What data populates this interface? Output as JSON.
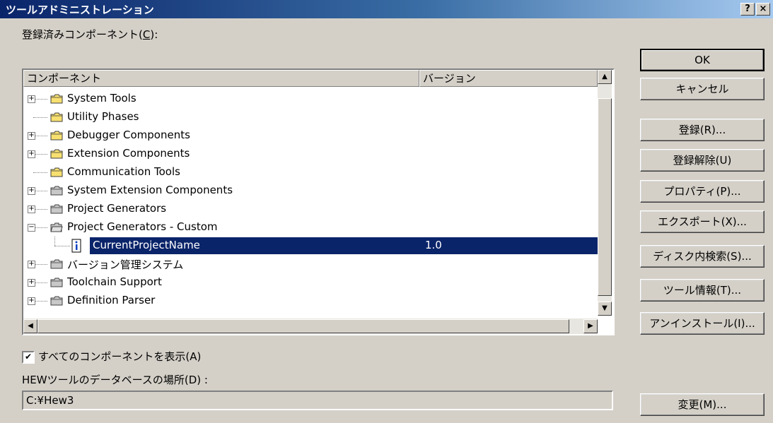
{
  "window": {
    "title": "ツールアドミニストレーション",
    "help_button": "?",
    "close_button": "×"
  },
  "components_label": {
    "text": "登録済みコンポーネント(",
    "mnemonic": "C",
    "suffix": "):"
  },
  "list": {
    "columns": [
      "コンポーネント",
      "バージョン"
    ],
    "rows": [
      {
        "name": "System Tools",
        "icon": "folder-yellow-icon",
        "expander": "+",
        "level": 0,
        "version": "",
        "selected": false
      },
      {
        "name": "Utility Phases",
        "icon": "folder-yellow-icon",
        "expander": "",
        "level": 0,
        "version": "",
        "selected": false
      },
      {
        "name": "Debugger Components",
        "icon": "folder-yellow-icon",
        "expander": "+",
        "level": 0,
        "version": "",
        "selected": false
      },
      {
        "name": "Extension Components",
        "icon": "folder-yellow-icon",
        "expander": "+",
        "level": 0,
        "version": "",
        "selected": false
      },
      {
        "name": "Communication Tools",
        "icon": "folder-yellow-icon",
        "expander": "",
        "level": 0,
        "version": "",
        "selected": false
      },
      {
        "name": "System Extension Components",
        "icon": "folder-gray-icon",
        "expander": "+",
        "level": 0,
        "version": "",
        "selected": false
      },
      {
        "name": "Project Generators",
        "icon": "folder-gray-icon",
        "expander": "+",
        "level": 0,
        "version": "",
        "selected": false
      },
      {
        "name": "Project Generators - Custom",
        "icon": "folder-open-gray-icon",
        "expander": "−",
        "level": 0,
        "version": "",
        "selected": false
      },
      {
        "name": "CurrentProjectName",
        "icon": "info-document-icon",
        "expander": "",
        "level": 1,
        "version": "1.0",
        "selected": true
      },
      {
        "name": "バージョン管理システム",
        "icon": "folder-gray-icon",
        "expander": "+",
        "level": 0,
        "version": "",
        "selected": false
      },
      {
        "name": "Toolchain Support",
        "icon": "folder-gray-icon",
        "expander": "+",
        "level": 0,
        "version": "",
        "selected": false
      },
      {
        "name": "Definition Parser",
        "icon": "folder-gray-icon",
        "expander": "+",
        "level": 0,
        "version": "",
        "selected": false
      }
    ]
  },
  "buttons": [
    {
      "id": "ok",
      "label": "OK",
      "default": true
    },
    {
      "id": "cancel",
      "label": "キャンセル"
    },
    {
      "id": "register",
      "label": "登録(R)..."
    },
    {
      "id": "unregister",
      "label": "登録解除(U)"
    },
    {
      "id": "properties",
      "label": "プロパティ(P)..."
    },
    {
      "id": "export",
      "label": "エクスポート(X)..."
    },
    {
      "id": "search-disk",
      "label": "ディスク内検索(S)..."
    },
    {
      "id": "tool-info",
      "label": "ツール情報(T)..."
    },
    {
      "id": "uninstall",
      "label": "アンインストール(I)..."
    },
    {
      "id": "change",
      "label": "変更(M)..."
    }
  ],
  "show_all": {
    "checked": true,
    "check_mark": "✔",
    "label": "すべてのコンポーネントを表示(A)"
  },
  "db_location": {
    "label": "HEWツールのデータベースの場所(D) :",
    "value": "C:¥Hew3"
  },
  "colors": {
    "selection": "#0a246a",
    "face": "#d4d0c8",
    "folder_yellow": "#f8e070",
    "folder_gray": "#c8c8c8"
  }
}
